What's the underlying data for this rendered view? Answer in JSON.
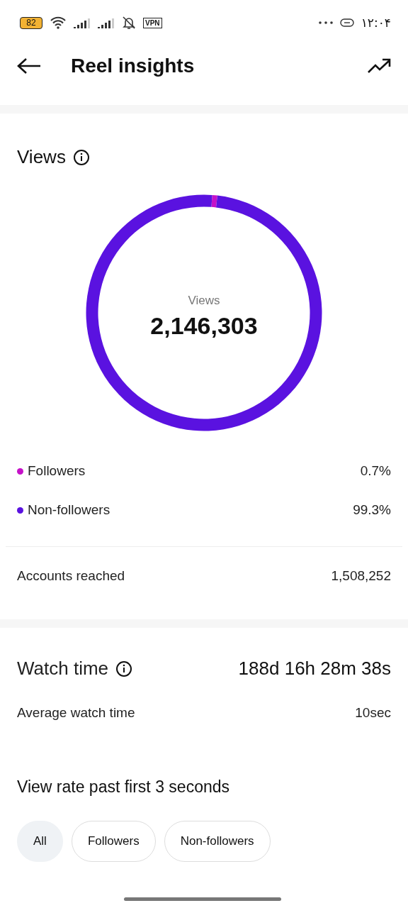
{
  "status_bar": {
    "battery": "82",
    "vpn": "VPN",
    "time": "۱۲:۰۴"
  },
  "header": {
    "title": "Reel insights"
  },
  "views": {
    "title": "Views",
    "center_label": "Views",
    "center_value": "2,146,303",
    "chart_data": {
      "type": "donut",
      "categories": [
        "Followers",
        "Non-followers"
      ],
      "values": [
        0.7,
        99.3
      ]
    },
    "legend": [
      {
        "value": "0.7%",
        "color": "#c511c8"
      },
      {
        "value": "99.3%",
        "color": "#5a12e0"
      }
    ],
    "accounts_reached": {
      "label": "Accounts reached",
      "value": "1,508,252"
    }
  },
  "watch_time": {
    "title": "Watch time",
    "total": "188d 16h 28m 38s",
    "average": {
      "label": "Average watch time",
      "value": "10sec"
    }
  },
  "view_rate": {
    "title": "View rate past first 3 seconds",
    "filters": [
      {
        "label": "All",
        "selected": true
      },
      {
        "label": "Followers",
        "selected": false
      },
      {
        "label": "Non-followers",
        "selected": false
      }
    ]
  }
}
